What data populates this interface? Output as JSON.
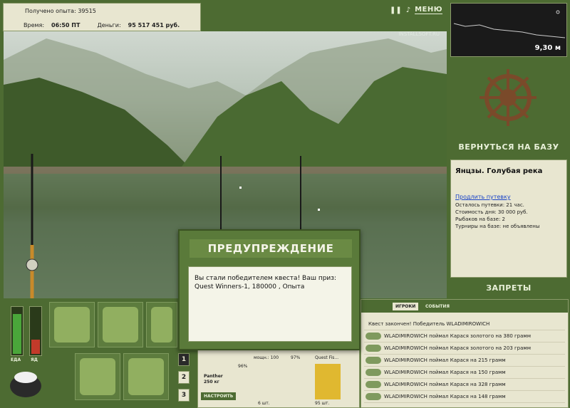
{
  "hud": {
    "experience_label": "Получено опыта:",
    "experience_value": "39515",
    "time_label": "Время:",
    "time_value": "06:50 ПТ",
    "money_label": "Деньги:",
    "money_value": "95 517 451 руб."
  },
  "top_menu": {
    "pause_icon": "pause-icon",
    "sound_icon": "sound-icon",
    "menu_label": "МЕНЮ"
  },
  "watermark": "INSTALLSOFT.RU",
  "depth": {
    "value": "9,30 м"
  },
  "right_panel": {
    "return_base_label": "ВЕРНУТЬСЯ НА БАЗУ",
    "location_title": "Янцзы. Голубая река",
    "extend_ticket_link": "Продлить путевку",
    "ticket_left": "Осталось путевки: 21 час.",
    "day_cost": "Стоимость дня: 30 000 руб.",
    "fishers_on_base": "Рыбаков на базе: 2",
    "tournaments": "Турниры на базе: не объявлены",
    "bans_label": "ЗАПРЕТЫ"
  },
  "gauges": {
    "food_label": "ЕДА",
    "poison_label": "ЯД",
    "food_level": 0.85,
    "poison_level": 0.3
  },
  "rod_slots": [
    "1",
    "2",
    "3"
  ],
  "tackle": {
    "rod_name": "Panther",
    "rod_load": "250 кг",
    "configure_label": "НАСТРОИТЬ",
    "pct1": "96%",
    "power_label": "мощн.: 100",
    "pct2": "97%",
    "quest_label": "Quest Fis...",
    "count1": "6 шт.",
    "count2": "95 шт."
  },
  "events": {
    "tab_players": "ИГРОКИ",
    "tab_events": "СОБЫТИЯ",
    "items": [
      "Квест закончен! Победитель WLADIMIROWICH",
      "WLADIMIROWICH поймал Карася золотого на 380 грамм",
      "WLADIMIROWICH поймал Карася золотого на 203 грамм",
      "WLADIMIROWICH поймал Карася на 215 грамм",
      "WLADIMIROWICH поймал Карася на 150 грамм",
      "WLADIMIROWICH поймал Карася на 328 грамм",
      "WLADIMIROWICH поймал Карася на 148 грамм"
    ]
  },
  "modal": {
    "title": "ПРЕДУПРЕЖДЕНИЕ",
    "message": "Вы стали победителем квеста! Ваш приз: Quest Winners-1, 180000 , Опыта"
  }
}
